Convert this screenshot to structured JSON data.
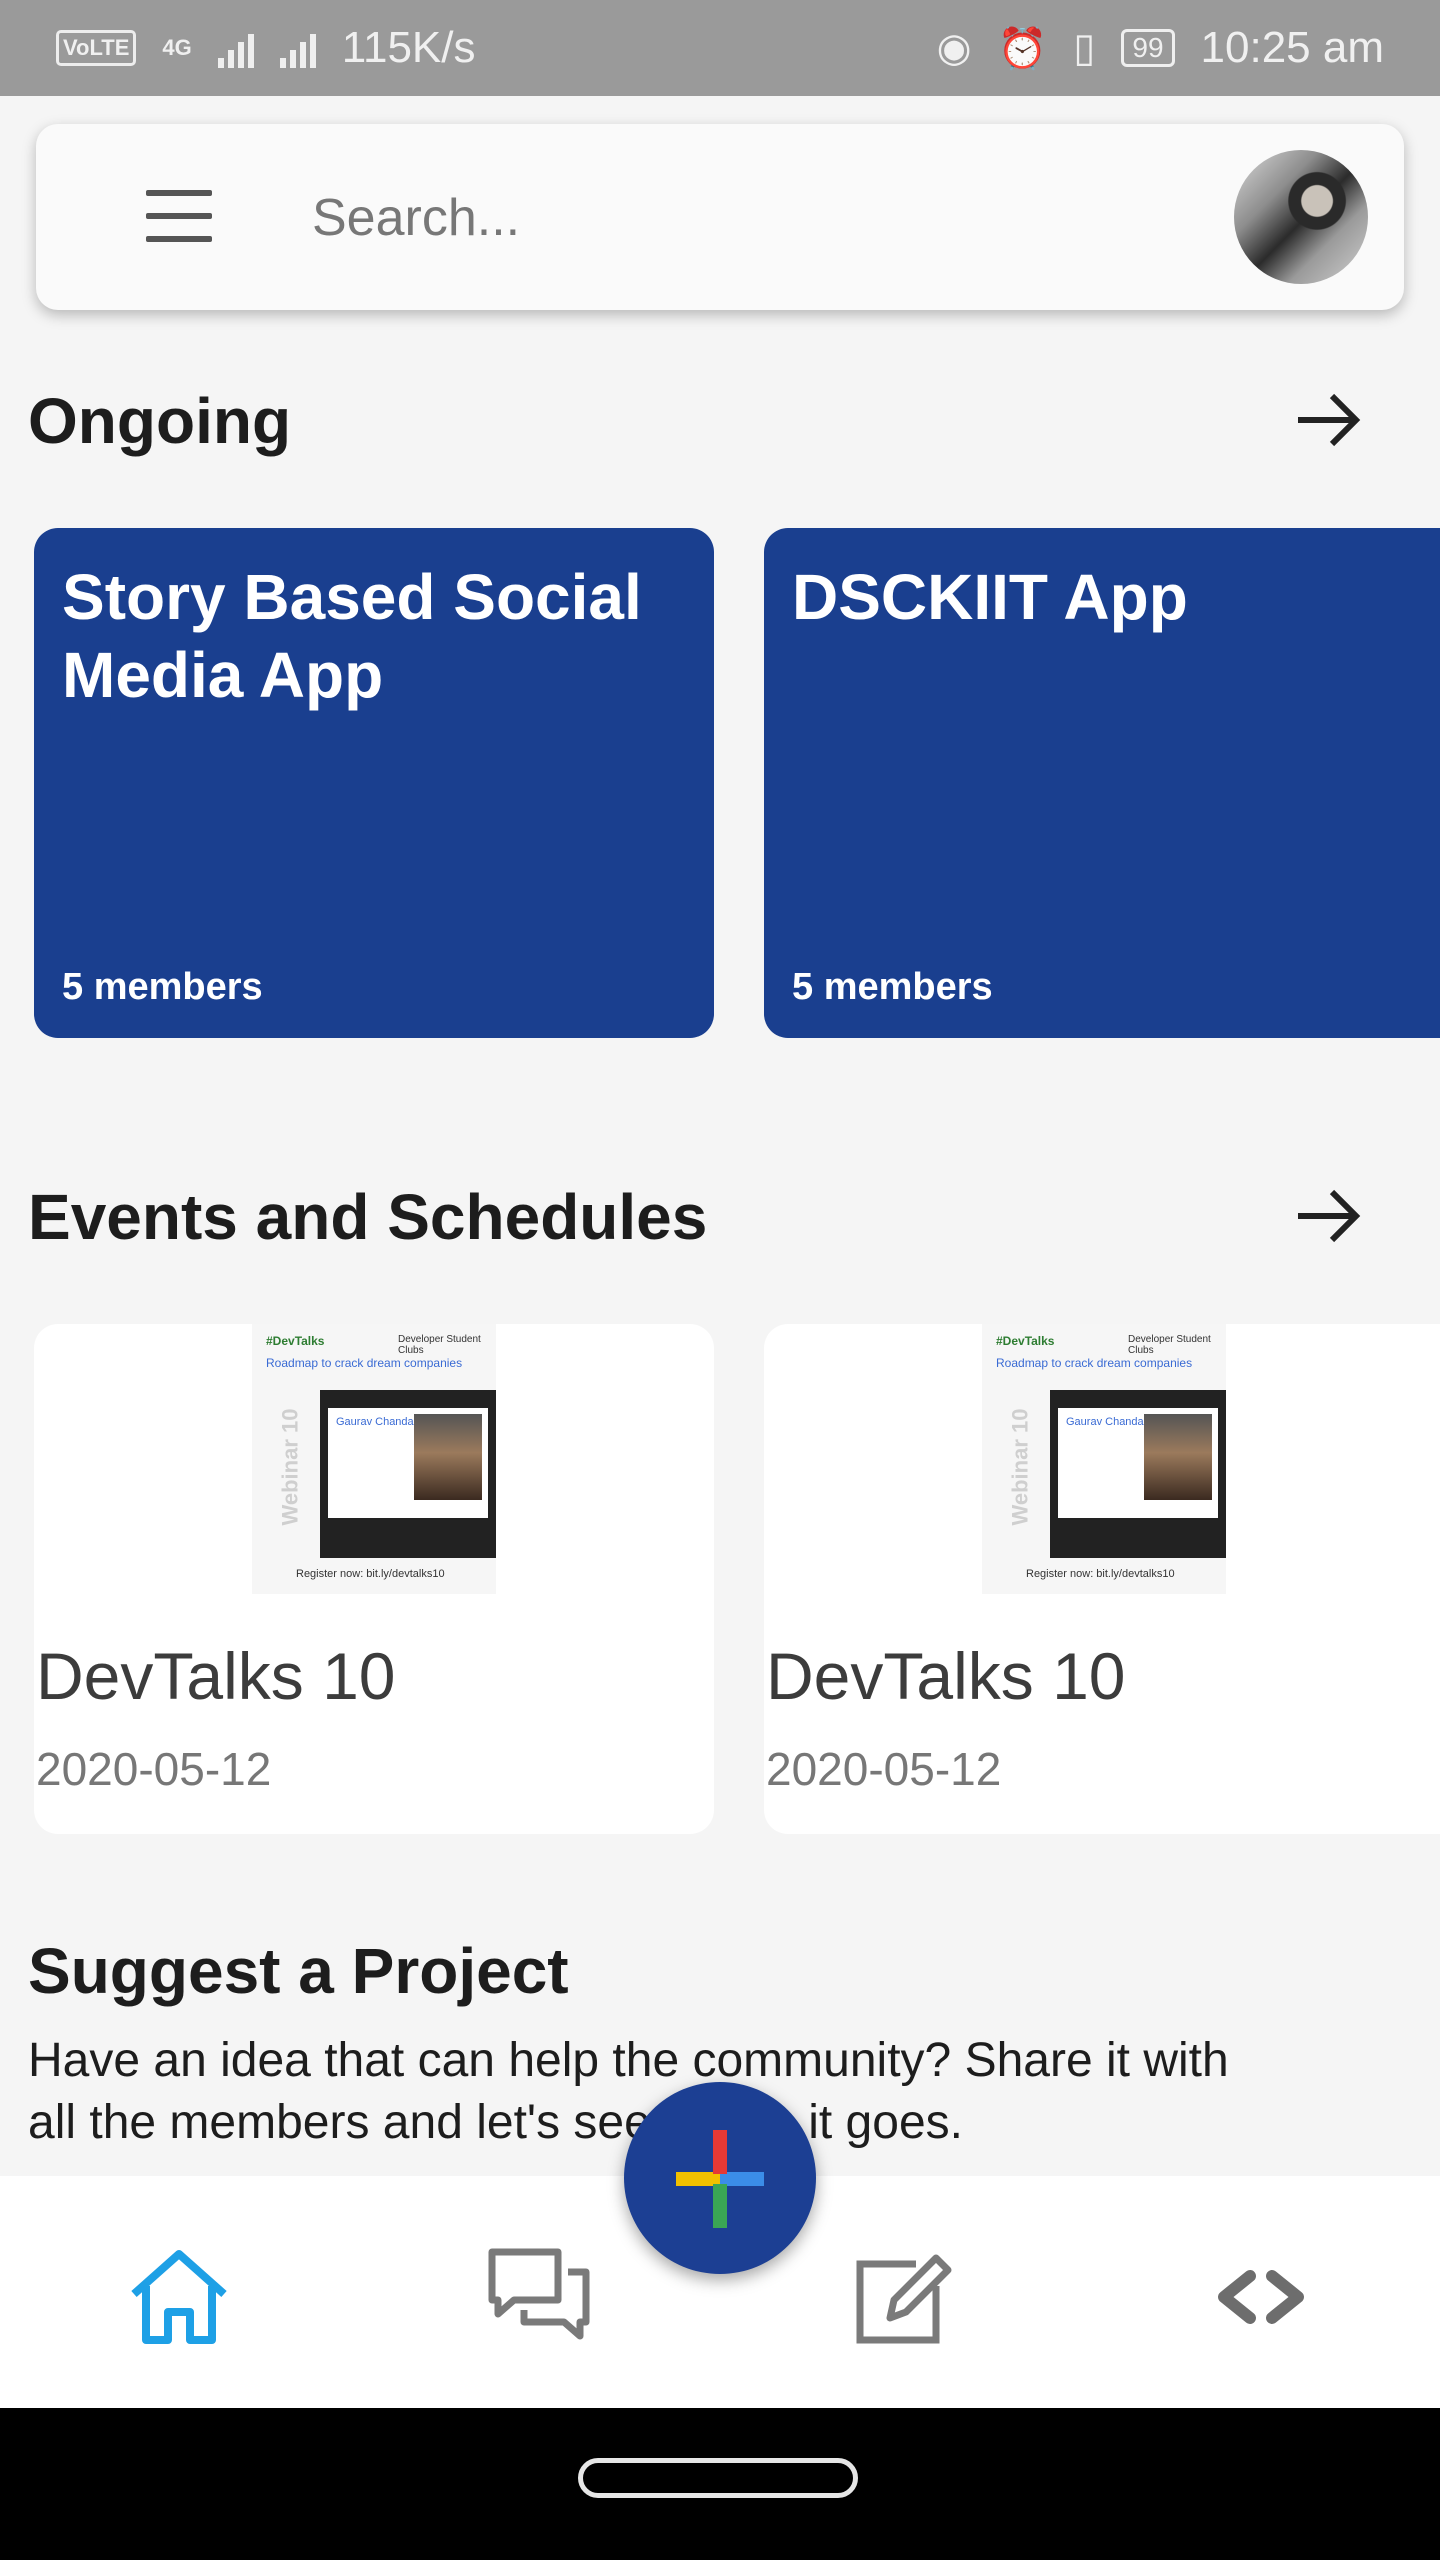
{
  "status_bar": {
    "volte": "VoLTE",
    "net": "4G",
    "speed": "115K/s",
    "battery": "99",
    "time": "10:25 am"
  },
  "search": {
    "placeholder": "Search...",
    "menu_icon": "hamburger-menu-icon",
    "avatar": "profile-avatar"
  },
  "ongoing": {
    "title": "Ongoing",
    "arrow_icon": "arrow-right-icon",
    "projects": [
      {
        "title": "Story Based Social Media App",
        "members": "5 members"
      },
      {
        "title": "DSCKIIT App",
        "members": "5 members"
      }
    ]
  },
  "events": {
    "title": "Events and Schedules",
    "arrow_icon": "arrow-right-icon",
    "items": [
      {
        "title": "DevTalks 10",
        "date": "2020-05-12"
      },
      {
        "title": "DevTalks 10",
        "date": "2020-05-12"
      }
    ]
  },
  "suggest": {
    "title": "Suggest a Project",
    "description": "Have an idea that can help the community? Share it with all the members and let's see where it goes."
  },
  "bottom_nav": {
    "items": [
      "home-icon",
      "chat-icon",
      "edit-icon",
      "code-icon"
    ],
    "fab_icon": "plus-icon"
  },
  "colors": {
    "primary": "#1a3f8f",
    "active_nav": "#1ea0e6",
    "inactive_nav": "#7a7a7a"
  }
}
